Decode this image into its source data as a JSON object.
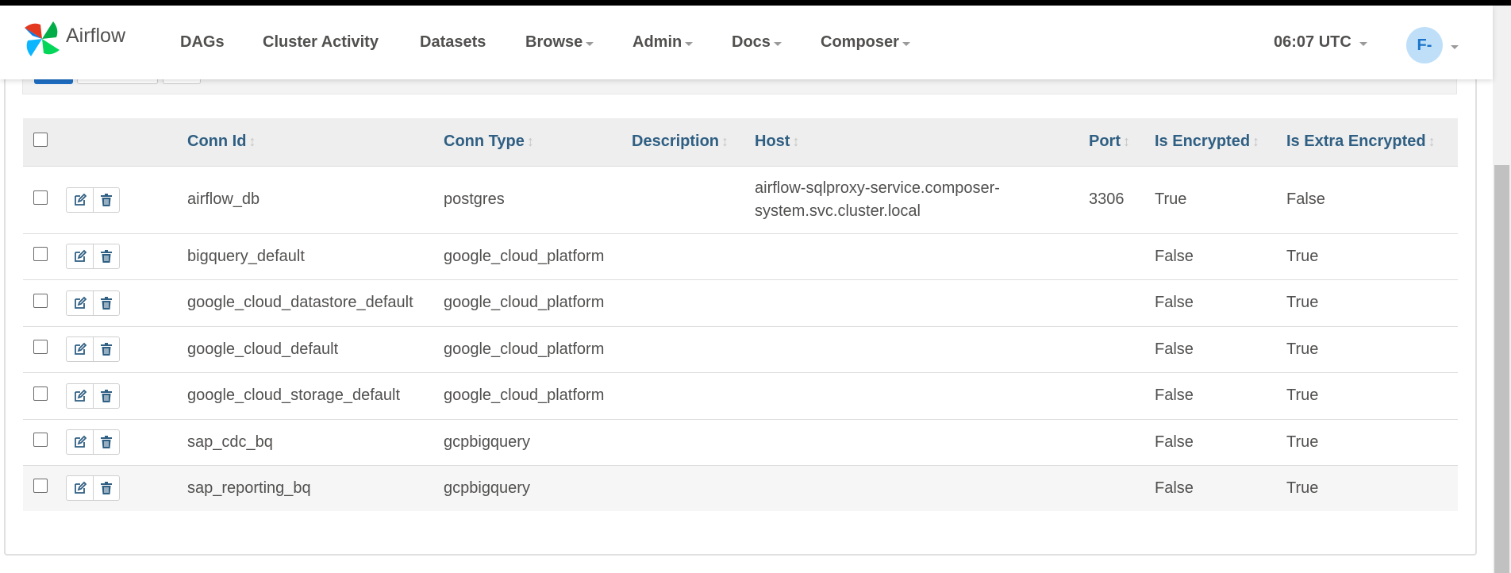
{
  "app": {
    "name": "Airflow"
  },
  "nav": {
    "items": [
      {
        "label": "DAGs",
        "dropdown": false
      },
      {
        "label": "Cluster Activity",
        "dropdown": false
      },
      {
        "label": "Datasets",
        "dropdown": false
      },
      {
        "label": "Browse",
        "dropdown": true
      },
      {
        "label": "Admin",
        "dropdown": true
      },
      {
        "label": "Docs",
        "dropdown": true
      },
      {
        "label": "Composer",
        "dropdown": true
      }
    ],
    "clock": "06:07 UTC",
    "user_initials": "F-"
  },
  "table": {
    "headers": {
      "conn_id": "Conn Id",
      "conn_type": "Conn Type",
      "description": "Description",
      "host": "Host",
      "port": "Port",
      "is_encrypted": "Is Encrypted",
      "is_extra_encrypted": "Is Extra Encrypted"
    },
    "rows": [
      {
        "conn_id": "airflow_db",
        "conn_type": "postgres",
        "description": "",
        "host_line1": "airflow-sqlproxy-service.composer-",
        "host_line2": "system.svc.cluster.local",
        "port": "3306",
        "is_encrypted": "True",
        "is_extra_encrypted": "False"
      },
      {
        "conn_id": "bigquery_default",
        "conn_type": "google_cloud_platform",
        "description": "",
        "host_line1": "",
        "host_line2": "",
        "port": "",
        "is_encrypted": "False",
        "is_extra_encrypted": "True"
      },
      {
        "conn_id": "google_cloud_datastore_default",
        "conn_type": "google_cloud_platform",
        "description": "",
        "host_line1": "",
        "host_line2": "",
        "port": "",
        "is_encrypted": "False",
        "is_extra_encrypted": "True"
      },
      {
        "conn_id": "google_cloud_default",
        "conn_type": "google_cloud_platform",
        "description": "",
        "host_line1": "",
        "host_line2": "",
        "port": "",
        "is_encrypted": "False",
        "is_extra_encrypted": "True"
      },
      {
        "conn_id": "google_cloud_storage_default",
        "conn_type": "google_cloud_platform",
        "description": "",
        "host_line1": "",
        "host_line2": "",
        "port": "",
        "is_encrypted": "False",
        "is_extra_encrypted": "True"
      },
      {
        "conn_id": "sap_cdc_bq",
        "conn_type": "gcpbigquery",
        "description": "",
        "host_line1": "",
        "host_line2": "",
        "port": "",
        "is_encrypted": "False",
        "is_extra_encrypted": "True"
      },
      {
        "conn_id": "sap_reporting_bq",
        "conn_type": "gcpbigquery",
        "description": "",
        "host_line1": "",
        "host_line2": "",
        "port": "",
        "is_encrypted": "False",
        "is_extra_encrypted": "True"
      }
    ]
  },
  "colors": {
    "header_text": "#2f5f83",
    "primary": "#1f6fc5",
    "avatar_bg": "#bfdff9"
  },
  "icons": {
    "edit": "edit-icon",
    "delete": "trash-icon",
    "sort": "sort-icon"
  }
}
